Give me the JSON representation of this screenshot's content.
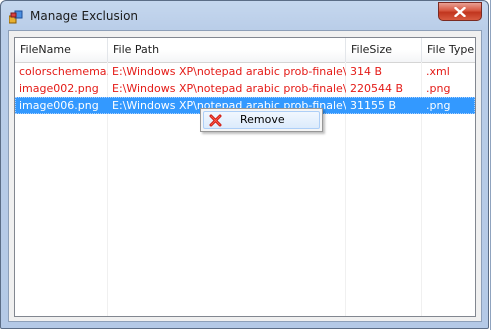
{
  "window": {
    "title": "Manage Exclusion"
  },
  "icons": {
    "app": "app-icon",
    "close": "close-icon",
    "remove": "remove-x-icon"
  },
  "colors": {
    "row_text": "#e41b17",
    "selection": "#3399ff",
    "close_button": "#c1351e"
  },
  "listview": {
    "columns": [
      {
        "label": "FileName"
      },
      {
        "label": "File Path"
      },
      {
        "label": "FileSize"
      },
      {
        "label": "File Type"
      }
    ],
    "rows": [
      {
        "name": "colorschemema...",
        "path": "E:\\Windows XP\\notepad arabic prob-finale\\a...",
        "size": "314 B",
        "type": ".xml",
        "selected": false
      },
      {
        "name": "image002.png",
        "path": "E:\\Windows XP\\notepad arabic prob-finale\\c...",
        "size": "220544 B",
        "type": ".png",
        "selected": false
      },
      {
        "name": "image006.png",
        "path": "E:\\Windows XP\\notepad arabic prob-finale\\c...",
        "size": "31155 B",
        "type": ".png",
        "selected": true
      }
    ]
  },
  "context_menu": {
    "items": [
      {
        "label": "Remove"
      }
    ]
  }
}
